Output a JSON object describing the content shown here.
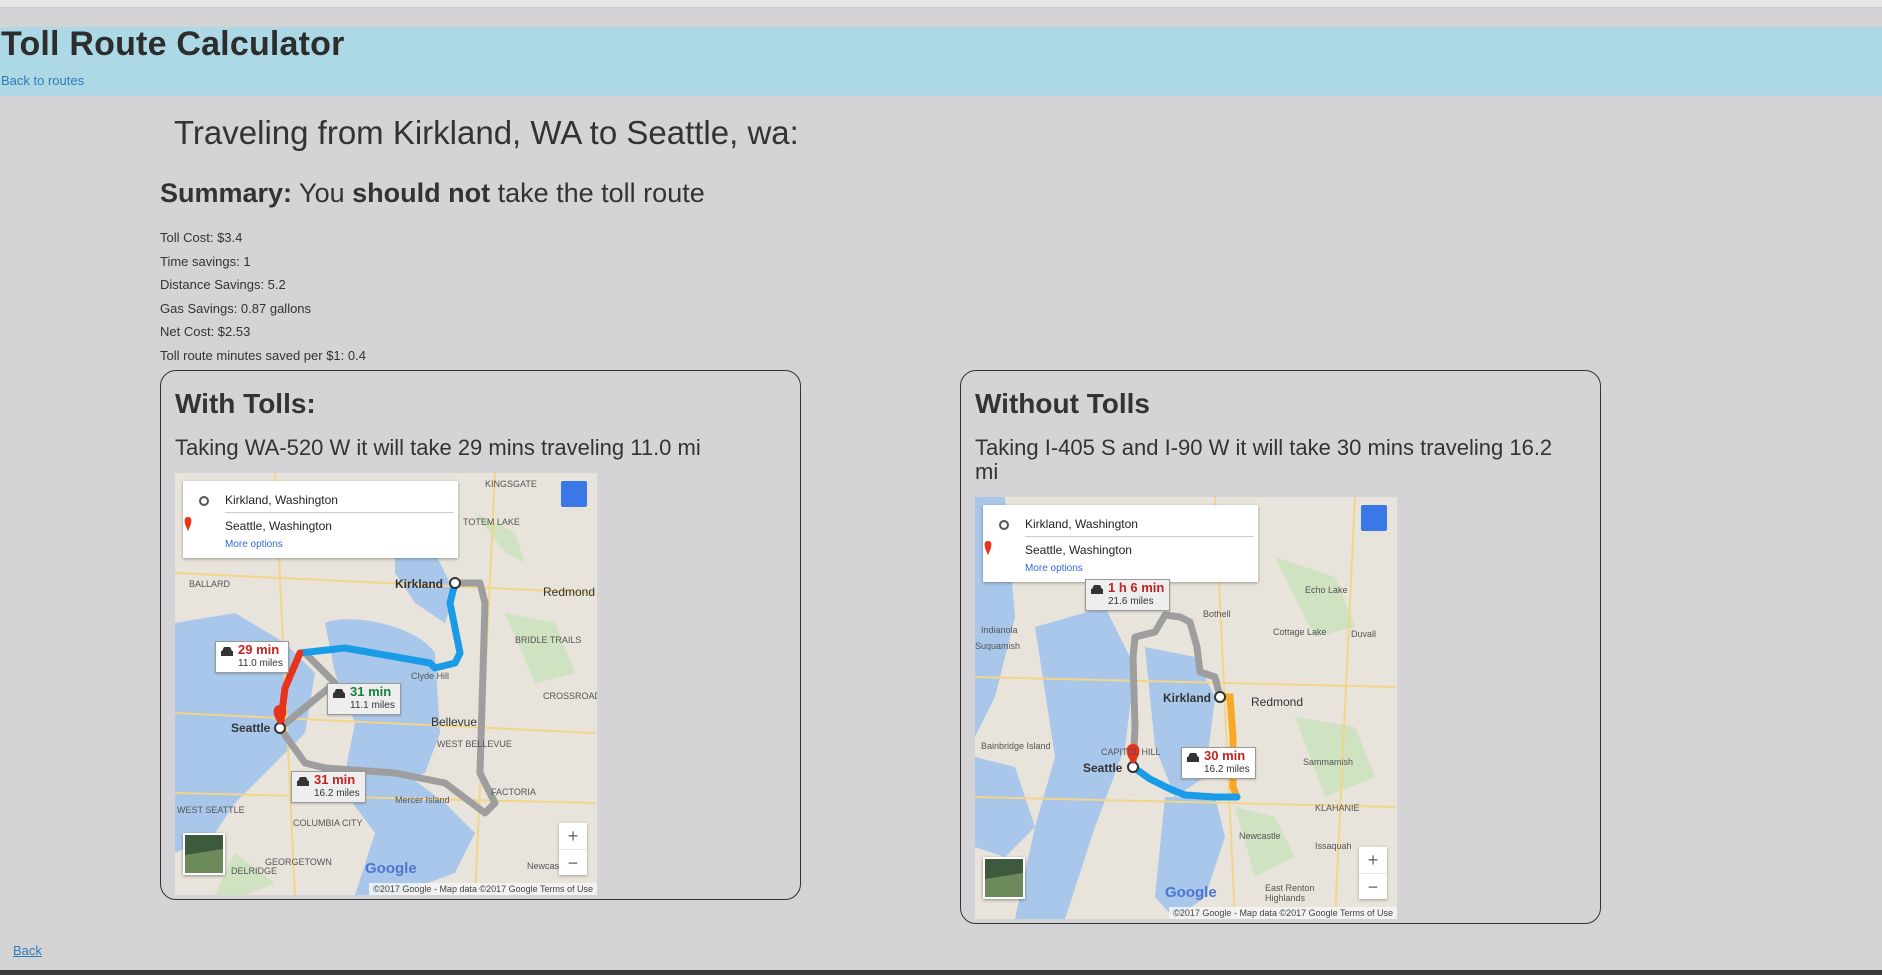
{
  "header": {
    "title": "Toll Route Calculator",
    "back_link": "Back to routes"
  },
  "trip": {
    "heading": "Traveling from Kirkland, WA to Seattle, wa:"
  },
  "summary": {
    "label": "Summary:",
    "text_before": " You ",
    "emphasis": "should not",
    "text_after": " take the toll route"
  },
  "stats": [
    "Toll Cost: $3.4",
    "Time savings: 1",
    "Distance Savings: 5.2",
    "Gas Savings: 0.87 gallons",
    "Net Cost: $2.53",
    "Toll route minutes saved per $1: 0.4"
  ],
  "with_tolls": {
    "title": "With Tolls:",
    "description": "Taking WA-520 W it will take 29 mins traveling 11.0 mi",
    "map": {
      "origin": "Kirkland, Washington",
      "destination": "Seattle, Washington",
      "more_options": "More options",
      "routes": [
        {
          "time": "29 min",
          "distance": "11.0 miles",
          "color": "#c5221f"
        },
        {
          "time": "31 min",
          "distance": "11.1 miles",
          "color": "#188038"
        },
        {
          "time": "31 min",
          "distance": "16.2 miles",
          "color": "#c5221f"
        }
      ],
      "labels": [
        "Kirkland",
        "Redmond",
        "Seattle",
        "Bellevue",
        "Clyde Hill",
        "Mercer Island",
        "BALLARD",
        "KINGSGATE",
        "TOTEM LAKE",
        "BRIDLE TRAILS",
        "CROSSROADS",
        "WEST BELLEVUE",
        "FACTORIA",
        "Newcastle",
        "COLUMBIA CITY",
        "GEORGETOWN",
        "DELRIDGE",
        "WEST SEATTLE"
      ],
      "logo": "Google",
      "credits": "©2017 Google - Map data ©2017 Google   Terms of Use",
      "zoom_in": "+",
      "zoom_out": "−"
    }
  },
  "without_tolls": {
    "title": "Without Tolls",
    "description": "Taking I-405 S and I-90 W it will take 30 mins traveling 16.2 mi",
    "map": {
      "origin": "Kirkland, Washington",
      "destination": "Seattle, Washington",
      "more_options": "More options",
      "routes": [
        {
          "time": "1 h 6 min",
          "distance": "21.6 miles",
          "color": "#c5221f"
        },
        {
          "time": "30 min",
          "distance": "16.2 miles",
          "color": "#c5221f"
        }
      ],
      "labels": [
        "Kirkland",
        "Redmond",
        "Seattle",
        "Bothell",
        "Echo Lake",
        "Cottage Lake",
        "Duvall",
        "Indianola",
        "Suquamish",
        "Bainbridge Island",
        "Sammamish",
        "Newcastle",
        "Issaquah",
        "KLAHANIE",
        "East Renton Highlands",
        "CAPITOL HILL"
      ],
      "logo": "Google",
      "credits": "©2017 Google - Map data ©2017 Google   Terms of Use",
      "zoom_in": "+",
      "zoom_out": "−"
    }
  },
  "footer": {
    "back": "Back"
  },
  "colors": {
    "header_bg": "#add8e6",
    "page_bg": "#d4d4d6",
    "link": "#337ab7",
    "route_primary": "#1a9be8",
    "route_alt": "#9e9e9e"
  }
}
